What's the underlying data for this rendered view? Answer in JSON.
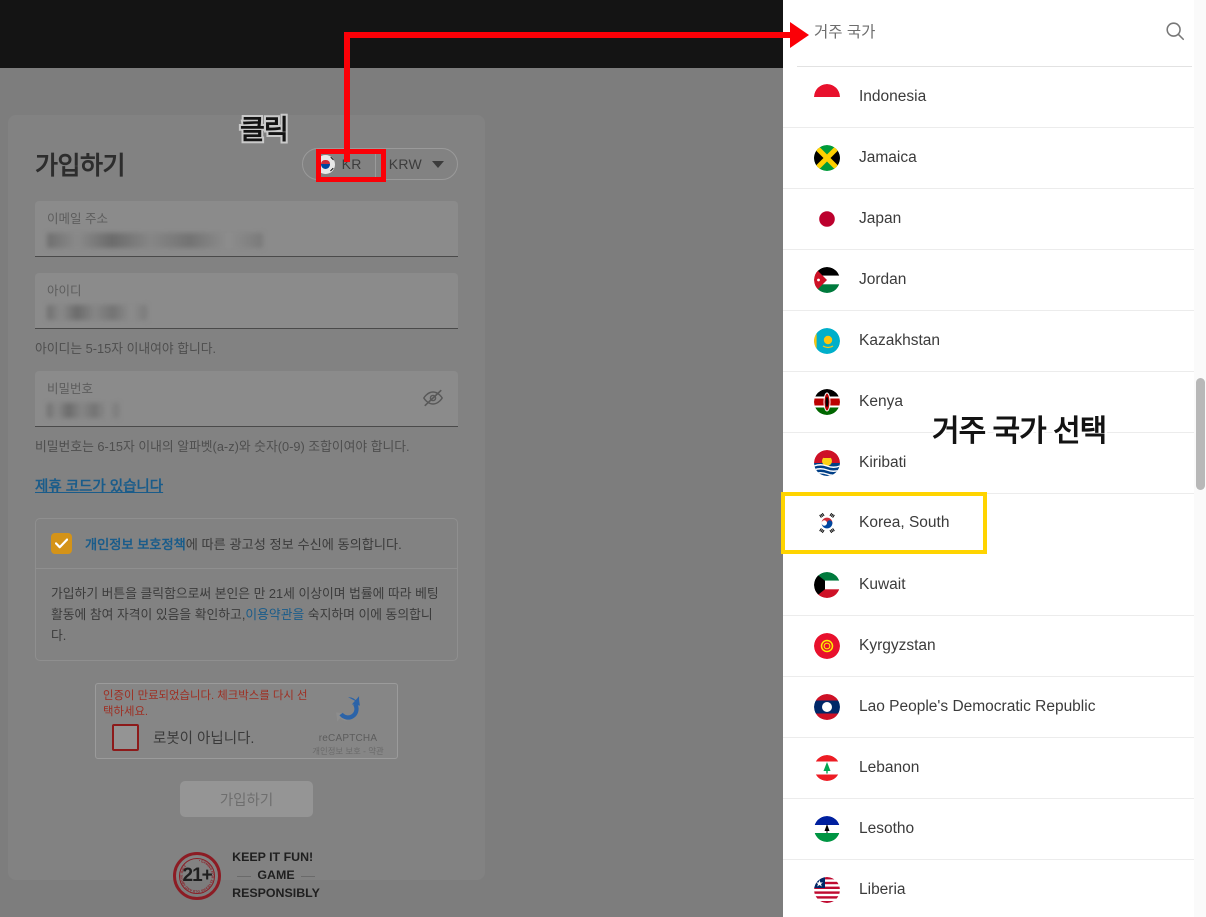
{
  "left": {
    "card": {
      "title": "가입하기",
      "country_toggle": {
        "flag": "kr-flag-icon",
        "code": "KR"
      },
      "currency_toggle": {
        "label": "KRW",
        "caret": "chevron-down-icon"
      },
      "fields": [
        {
          "label": "이메일 주소",
          "value": "",
          "redacted": true,
          "hint": ""
        },
        {
          "label": "아이디",
          "value": "",
          "redacted": true,
          "hint": "아이디는 5-15자 이내여야 합니다."
        },
        {
          "label": "비밀번호",
          "value": "",
          "redacted": true,
          "hint": "비밀번호는 6-15자 이내의 알파벳(a-z)와 숫자(0-9) 조합이여야 합니다.",
          "toggle_icon": "eye-off-icon"
        }
      ],
      "affiliate_link": "제휴 코드가 있습니다",
      "consent": {
        "checkbox_checked": true,
        "line1_link": "개인정보 보호정책",
        "line1_rest": "에 따른 광고성 정보 수신에 동의합니다.",
        "line2_a": "가입하기 버튼을 클릭함으로써 본인은 만 21세 이상이며 법률에 따라 베팅 활동에 참여 자격이 있음을 확인하고,",
        "line2_link": "이용약관을",
        "line2_b": " 숙지하며 이에 동의합니다."
      },
      "recaptcha": {
        "warning": "인증이 만료되었습니다. 체크박스를 다시 선택하세요.",
        "label": "로봇이 아닙니다.",
        "brand": "reCAPTCHA",
        "terms": "개인정보 보호 - 약관"
      },
      "submit_label": "가입하기",
      "age_badge": {
        "number": "21+",
        "ring_text": "GAMING FOR 21 YEARS OLD AND ABOVE ONLY",
        "line1": "KEEP IT FUN!",
        "line2": "GAME",
        "line3": "RESPONSIBLY"
      }
    }
  },
  "right": {
    "search": {
      "placeholder": "거주 국가",
      "value": "",
      "icon": "search-icon"
    },
    "countries": [
      {
        "name": "Indonesia",
        "flag": "flag-indonesia"
      },
      {
        "name": "Jamaica",
        "flag": "flag-jamaica"
      },
      {
        "name": "Japan",
        "flag": "flag-japan"
      },
      {
        "name": "Jordan",
        "flag": "flag-jordan"
      },
      {
        "name": "Kazakhstan",
        "flag": "flag-kazakhstan"
      },
      {
        "name": "Kenya",
        "flag": "flag-kenya"
      },
      {
        "name": "Kiribati",
        "flag": "flag-kiribati"
      },
      {
        "name": "Korea, South",
        "flag": "flag-korea-south"
      },
      {
        "name": "Kuwait",
        "flag": "flag-kuwait"
      },
      {
        "name": "Kyrgyzstan",
        "flag": "flag-kyrgyzstan"
      },
      {
        "name": "Lao People's Democratic Republic",
        "flag": "flag-laos"
      },
      {
        "name": "Lebanon",
        "flag": "flag-lebanon"
      },
      {
        "name": "Lesotho",
        "flag": "flag-lesotho"
      },
      {
        "name": "Liberia",
        "flag": "flag-liberia"
      }
    ],
    "scrollbar": {
      "name": "vertical-scrollbar"
    }
  },
  "annotations": {
    "click_label": "클릭",
    "select_label": "거주 국가 선택",
    "arrow_color": "#fb0007",
    "highlight_color": "#ffd400",
    "red_box_target": "KR",
    "yellow_box_target": "Korea, South"
  }
}
